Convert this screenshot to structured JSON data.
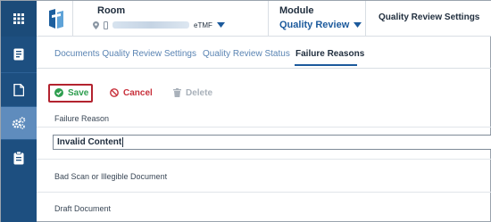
{
  "rail": {
    "icons": [
      "apps-grid-icon",
      "book-icon",
      "document-icon",
      "gears-icon",
      "clipboard-icon"
    ],
    "active_index": 3
  },
  "header": {
    "room_label": "Room",
    "room_badge": "eTMF",
    "module_label": "Module",
    "module_value": "Quality Review",
    "page_title": "Quality Review Settings"
  },
  "tabs": [
    {
      "label": "Documents Quality Review Settings",
      "active": false
    },
    {
      "label": "Quality Review Status",
      "active": false
    },
    {
      "label": "Failure Reasons",
      "active": true
    }
  ],
  "toolbar": {
    "save_label": "Save",
    "cancel_label": "Cancel",
    "delete_label": "Delete"
  },
  "table": {
    "column_header": "Failure Reason",
    "editing_value": "Invalid Content",
    "rows": [
      "Bad Scan or Illegible Document",
      "Draft Document"
    ]
  },
  "colors": {
    "rail": "#1d4f80",
    "rail_active": "#5f8cbd",
    "link_blue": "#1c5a9c",
    "save_green": "#2e9e4f",
    "cancel_red": "#c8303b",
    "delete_gray": "#a9b1ba",
    "highlight_box": "#b3232f"
  }
}
